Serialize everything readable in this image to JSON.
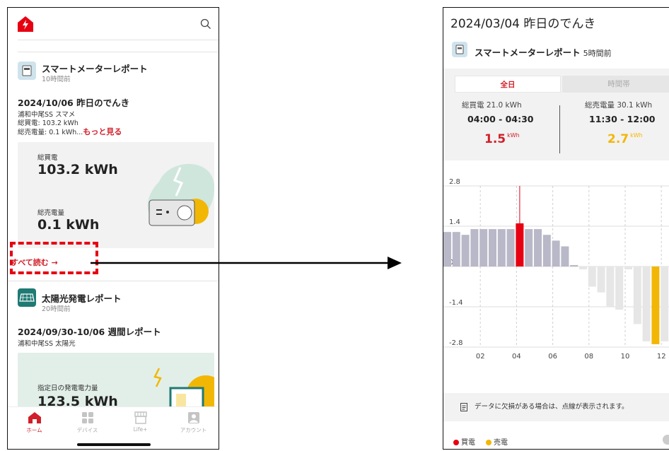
{
  "left": {
    "card1": {
      "title": "スマートメーターレポート",
      "time": "10時間前",
      "report_title": "2024/10/06 昨日のでんき",
      "line1": "浦和中尾SS スマメ",
      "line2": "総買電: 103.2 kWh",
      "line3": "総売電量: 0.1 kWh...",
      "more": "もっと見る",
      "buy_label": "総買電",
      "buy_value": "103.2 kWh",
      "sell_label": "総売電量",
      "sell_value": "0.1 kWh",
      "read_all": "すべて読む →"
    },
    "card2": {
      "title": "太陽光発電レポート",
      "time": "20時間前",
      "report_title": "2024/09/30-10/06 週間レポート",
      "line1": "浦和中尾SS 太陽光",
      "panel_label": "指定日の発電電力量",
      "panel_value": "123.5 kWh"
    },
    "nav": [
      {
        "label": "ホーム"
      },
      {
        "label": "デバイス"
      },
      {
        "label": "Life+"
      },
      {
        "label": "アカウント"
      }
    ]
  },
  "right": {
    "title": "2024/03/04 昨日のでんき",
    "sub_title": "スマートメーターレポート",
    "sub_time": "5時間前",
    "tab_all": "全日",
    "tab_hour": "時間帯",
    "buy_label": "総買電 21.0 kWh",
    "buy_time": "04:00 - 04:30",
    "buy_value": "1.5",
    "sell_label": "総売電量 30.1 kWh",
    "sell_time": "11:30 - 12:00",
    "sell_value": "2.7",
    "unit": "kWh",
    "note": "データに欠損がある場合は、点線が表示されます。",
    "legend_buy": "買電",
    "legend_sell": "売電"
  },
  "colors": {
    "brand_red": "#d0202a",
    "buy_bar": "#b8b8c8",
    "buy_highlight": "#e60012",
    "sell_bar": "#e6e6e6",
    "sell_highlight": "#f2b705",
    "dashed_box": "#e60012"
  },
  "chart_data": {
    "type": "bar",
    "x_ticks": [
      "02",
      "04",
      "06",
      "08",
      "10",
      "12"
    ],
    "ylim": [
      -2.8,
      2.8
    ],
    "y_ticks": [
      2.8,
      1.4,
      0.0,
      -1.4,
      -2.8
    ],
    "grid": true,
    "series": [
      {
        "name": "買電",
        "x": [
          0.0,
          0.5,
          1.0,
          1.5,
          2.0,
          2.5,
          3.0,
          3.5,
          4.0,
          4.5,
          5.0,
          5.5,
          6.0,
          6.5,
          7.0
        ],
        "values": [
          1.2,
          1.2,
          1.1,
          1.3,
          1.3,
          1.3,
          1.3,
          1.3,
          1.5,
          1.3,
          1.3,
          1.1,
          0.9,
          0.7,
          0.05
        ]
      },
      {
        "name": "売電",
        "x": [
          7.5,
          8.0,
          8.5,
          9.0,
          9.5,
          10.0,
          10.5,
          11.0,
          11.5,
          12.0,
          12.5
        ],
        "values": [
          -0.1,
          -0.7,
          -0.9,
          -1.4,
          -1.5,
          -0.1,
          -2.0,
          -2.6,
          -2.7,
          -2.6,
          -2.5
        ]
      }
    ],
    "highlight": {
      "buy_x": 4.0,
      "sell_x": 11.5
    },
    "legend": "bottom-left"
  }
}
